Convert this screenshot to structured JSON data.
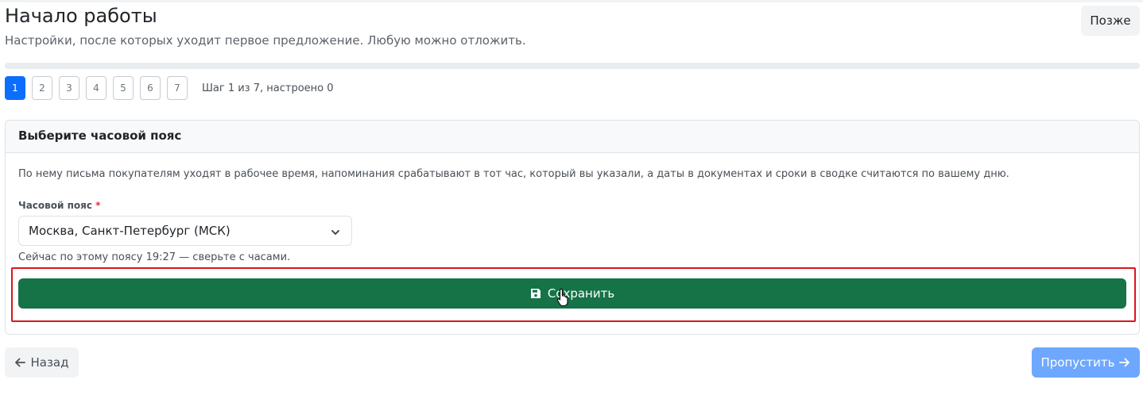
{
  "header": {
    "title": "Начало работы",
    "subtitle": "Настройки, после которых уходит первое предложение. Любую можно отложить.",
    "later_label": "Позже"
  },
  "progress": {
    "value_fraction": 0
  },
  "steps": {
    "items": [
      "1",
      "2",
      "3",
      "4",
      "5",
      "6",
      "7"
    ],
    "active_index": 0,
    "status": "Шаг 1 из 7, настроено 0"
  },
  "card": {
    "title": "Выберите часовой пояс",
    "description": "По нему письма покупателям уходят в рабочее время, напоминания срабатывают в тот час, который вы указали, а даты в документах и сроки в сводке считаются по вашему дню.",
    "field_label": "Часовой пояс",
    "required_mark": "*",
    "selected_value": "Москва, Санкт-Петербург (МСК)",
    "hint": "Сейчас по этому поясу 19:27 — сверьте с часами.",
    "save_label": "Сохранить"
  },
  "footer": {
    "back_label": "Назад",
    "skip_label": "Пропустить"
  },
  "colors": {
    "primary": "#0d6efd",
    "success": "#157347",
    "skip_disabled": "#6ea8fe",
    "highlight": "#d9151f",
    "required": "#dc3545"
  },
  "icons": {
    "save": "floppy-disk-icon",
    "chevron": "chevron-down-icon",
    "back": "arrow-left-icon",
    "skip": "arrow-right-icon",
    "cursor": "hand-pointer-icon"
  }
}
